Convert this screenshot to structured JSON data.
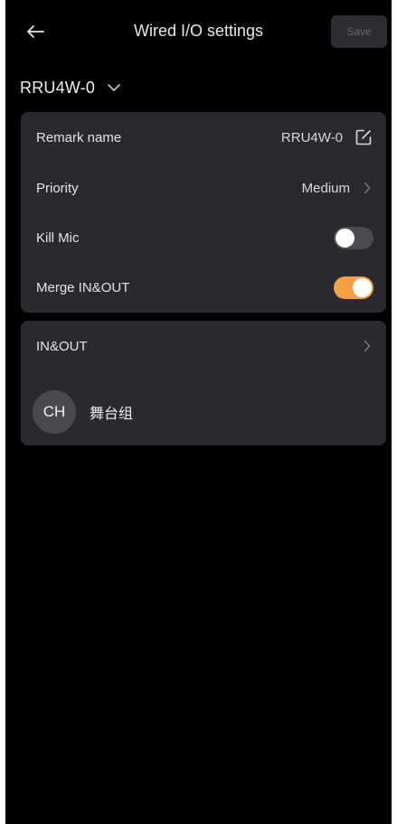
{
  "header": {
    "title": "Wired I/O settings",
    "back_icon": "arrow-left-icon",
    "save_label": "Save"
  },
  "device_selector": {
    "selected": "RRU4W-0",
    "icon": "chevron-down-icon"
  },
  "settings": {
    "remark_name": {
      "label": "Remark name",
      "value": "RRU4W-0",
      "icon": "edit-icon"
    },
    "priority": {
      "label": "Priority",
      "value": "Medium",
      "icon": "chevron-right-icon"
    },
    "kill_mic": {
      "label": "Kill Mic",
      "enabled": false
    },
    "merge_in_out": {
      "label": "Merge IN&OUT",
      "enabled": true
    }
  },
  "channel": {
    "label": "IN&OUT",
    "icon": "chevron-right-icon",
    "group": {
      "avatar_initials": "CH",
      "name": "舞台组"
    }
  },
  "colors": {
    "background": "#000000",
    "card": "#2a2a2e",
    "toggle_on": "#f3a046",
    "toggle_off": "#4a4a4f",
    "avatar": "#4a4a4e"
  }
}
